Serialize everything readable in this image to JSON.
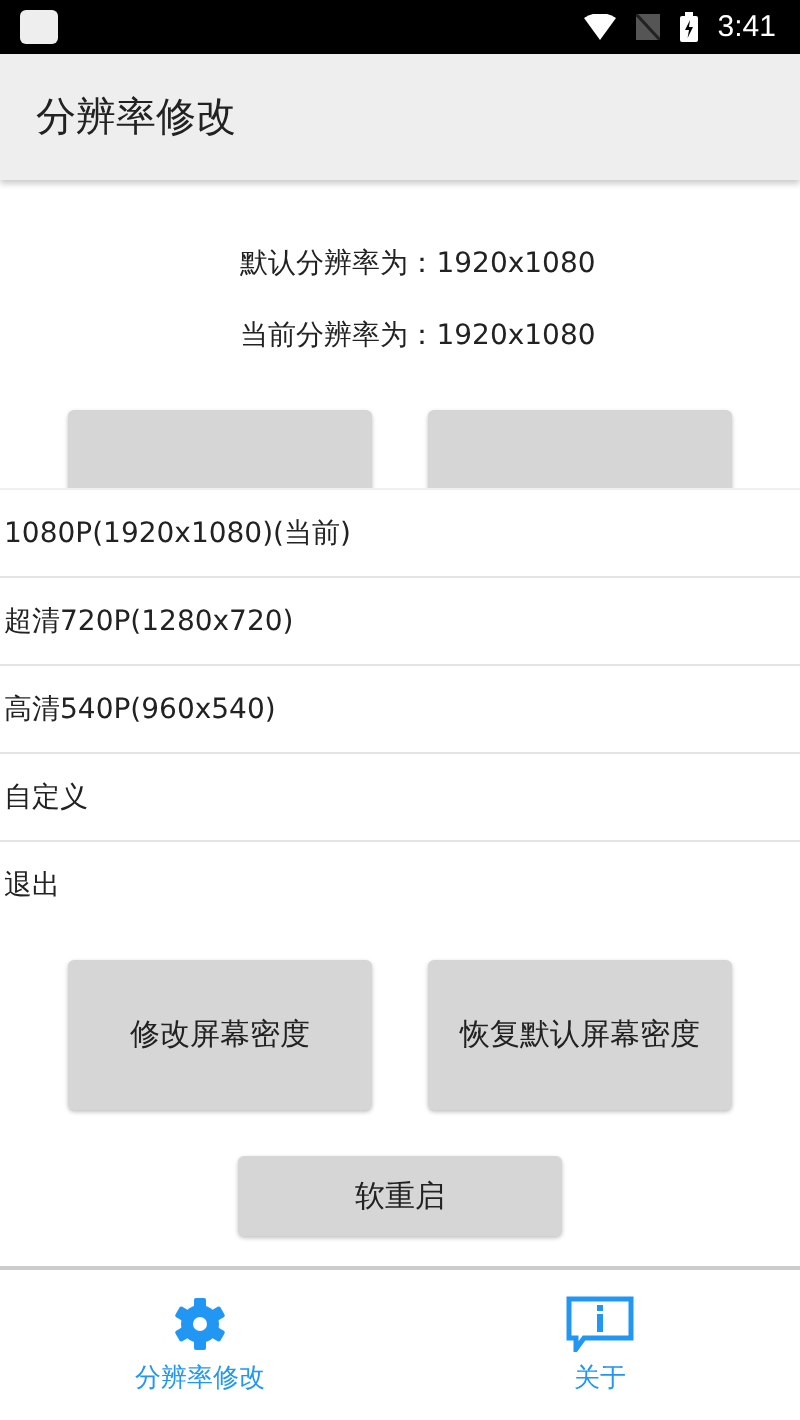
{
  "status_bar": {
    "time": "3:41"
  },
  "app_bar": {
    "title": "分辨率修改"
  },
  "info": [
    "默认分辨率为：1920x1080",
    "当前分辨率为：1920x1080"
  ],
  "menu": {
    "items": [
      "1080P(1920x1080)(当前)",
      "超清720P(1280x720)",
      "高清540P(960x540)",
      "自定义",
      "退出"
    ]
  },
  "bottom_buttons": [
    "修改屏幕密度",
    "恢复默认屏幕密度"
  ],
  "restart_button": "软重启",
  "bottom_nav": [
    {
      "kind": "gear",
      "label": "分辨率修改"
    },
    {
      "kind": "info",
      "label": "关于"
    }
  ]
}
